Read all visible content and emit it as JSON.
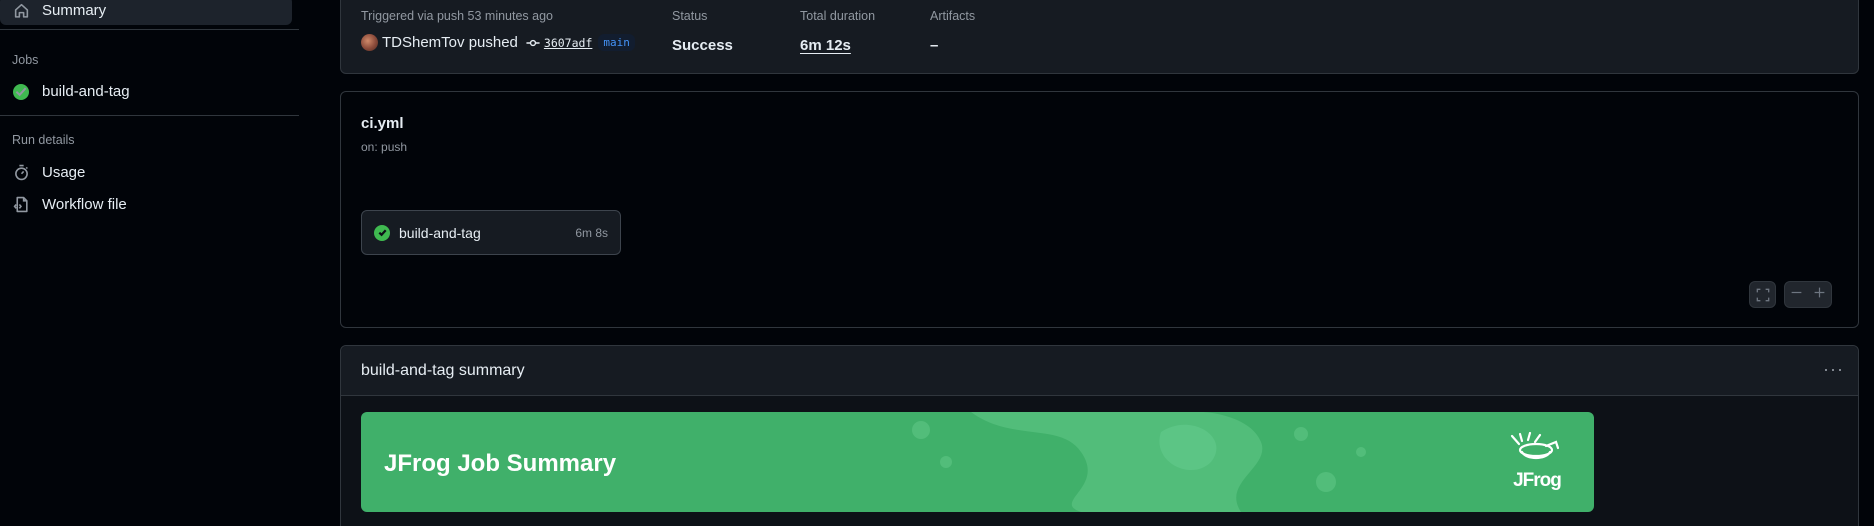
{
  "sidebar": {
    "summary_label": "Summary",
    "jobs_heading": "Jobs",
    "jobs": [
      {
        "label": "build-and-tag",
        "status": "success"
      }
    ],
    "run_details_heading": "Run details",
    "usage_label": "Usage",
    "workflow_file_label": "Workflow file"
  },
  "run_summary": {
    "trigger_text": "Triggered via push 53 minutes ago",
    "actor": "TDShemTov pushed",
    "commit_sha": "3607adf",
    "branch": "main",
    "status_label": "Status",
    "status_value": "Success",
    "duration_label": "Total duration",
    "duration_value": "6m 12s",
    "artifacts_label": "Artifacts",
    "artifacts_value": "–"
  },
  "workflow": {
    "file_name": "ci.yml",
    "trigger": "on: push",
    "job": {
      "name": "build-and-tag",
      "duration": "6m 8s"
    }
  },
  "job_summary": {
    "header": "build-and-tag summary",
    "banner_title": "JFrog Job Summary",
    "logo_text": "JFrog"
  },
  "colors": {
    "success": "#3fb950",
    "banner_green": "#40b06a",
    "branch_blue": "#4493f8"
  }
}
